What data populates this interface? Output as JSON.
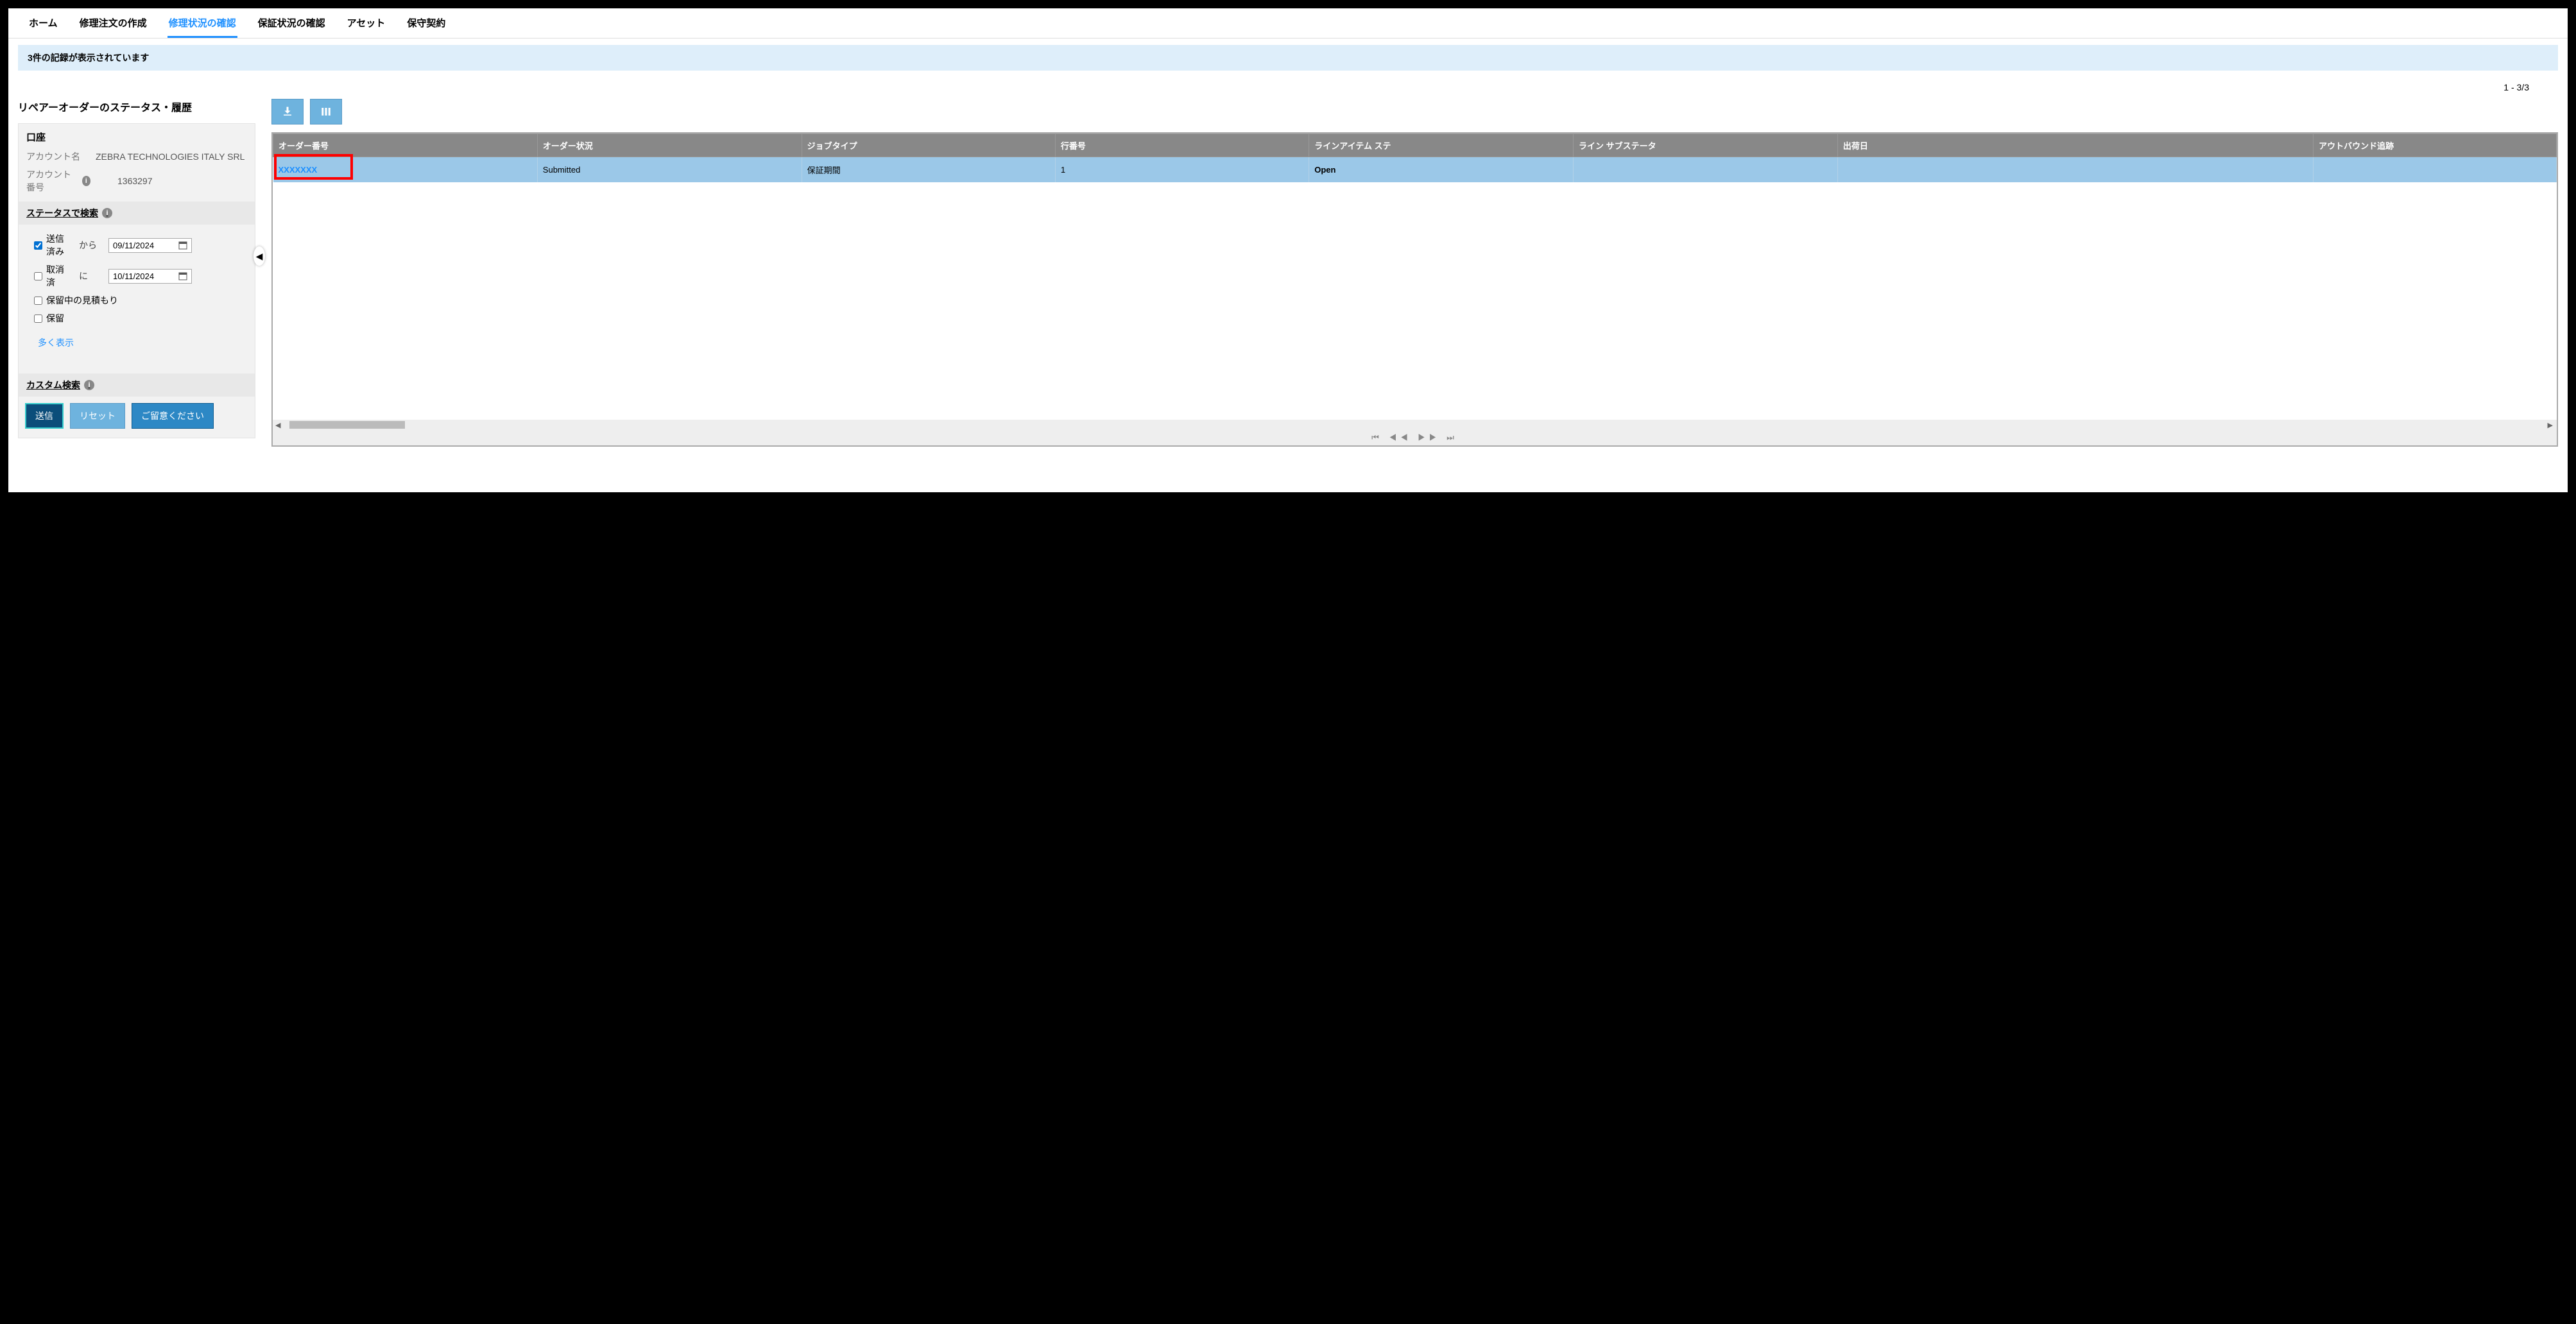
{
  "tabs": {
    "home": "ホーム",
    "create": "修理注文の作成",
    "status": "修理状況の確認",
    "warranty": "保証状況の確認",
    "asset": "アセット",
    "contract": "保守契約"
  },
  "notice": "3件の記録が表示されています",
  "page_count": "1 - 3/3",
  "section_title": "リペアーオーダーのステータス・履歴",
  "account": {
    "header": "口座",
    "name_label": "アカウント名",
    "name_value": "ZEBRA TECHNOLOGIES ITALY SRL",
    "num_label": "アカウント番号",
    "num_value": "1363297"
  },
  "status_search": {
    "header": "ステータスで検索",
    "opt_submitted": "送信済み",
    "opt_cancelled": "取消済",
    "opt_pending": "保留中の見積もり",
    "opt_hold": "保留",
    "from_label": "から",
    "to_label": "に",
    "date_from": "09/11/2024",
    "date_to": "10/11/2024",
    "more": "多く表示"
  },
  "custom_search": "カスタム検索",
  "buttons": {
    "submit": "送信",
    "reset": "リセット",
    "note": "ご留意ください"
  },
  "table": {
    "headers": {
      "order_no": "オーダー番号",
      "order_status": "オーダー状況",
      "job_type": "ジョブタイプ",
      "line_no": "行番号",
      "line_status": "ラインアイテム ステ",
      "line_sub": "ライン サブステータ",
      "ship_date": "出荷日",
      "outbound": "アウトバウンド追跡"
    },
    "row": {
      "order_no": "XXXXXXX",
      "order_status": "Submitted",
      "job_type": "保証期間",
      "line_no": "1",
      "line_status": "Open",
      "line_sub": "",
      "ship_date": "",
      "outbound": ""
    }
  },
  "pager": "⏮ ◀◀ ▶▶ ⏭"
}
